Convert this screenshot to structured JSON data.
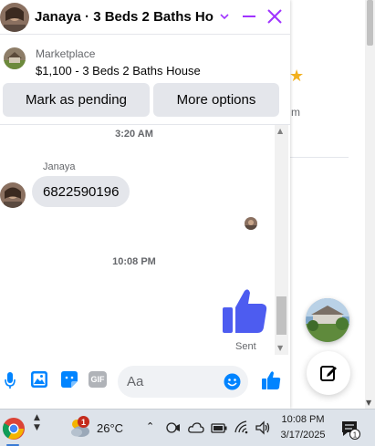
{
  "background": {
    "star": "★",
    "fragment_text": "m"
  },
  "header": {
    "title": "Janaya · 3 Beds 2 Baths Ho...",
    "chevron": "⌄"
  },
  "listing": {
    "source": "Marketplace",
    "title": "$1,100 - 3 Beds 2 Baths House"
  },
  "actions": {
    "pending_label": "Mark as pending",
    "more_label": "More options"
  },
  "messages": {
    "time1": "3:20 AM",
    "sender_name": "Janaya",
    "bubble_text": "6822590196",
    "time2": "10:08 PM",
    "sent_label": "Sent"
  },
  "composer": {
    "placeholder": "Aa",
    "gif_label": "GIF"
  },
  "taskbar": {
    "weather_badge": "1",
    "temperature": "26°C",
    "time": "10:08 PM",
    "date": "3/17/2025",
    "notification_count": "1"
  },
  "colors": {
    "accent": "#a033ff",
    "messenger_blue": "#0084ff",
    "thumb": "#4d5cf0",
    "bubble": "#e4e6eb"
  },
  "icons": [
    "mic-icon",
    "photo-icon",
    "sticker-icon",
    "gif-icon",
    "emoji-icon",
    "like-icon",
    "close-icon",
    "minimize-icon",
    "chevron-down-icon",
    "compose-icon",
    "chrome-icon",
    "weather-icon",
    "wifi-icon",
    "volume-icon",
    "battery-icon",
    "cloud-icon",
    "notification-icon"
  ]
}
